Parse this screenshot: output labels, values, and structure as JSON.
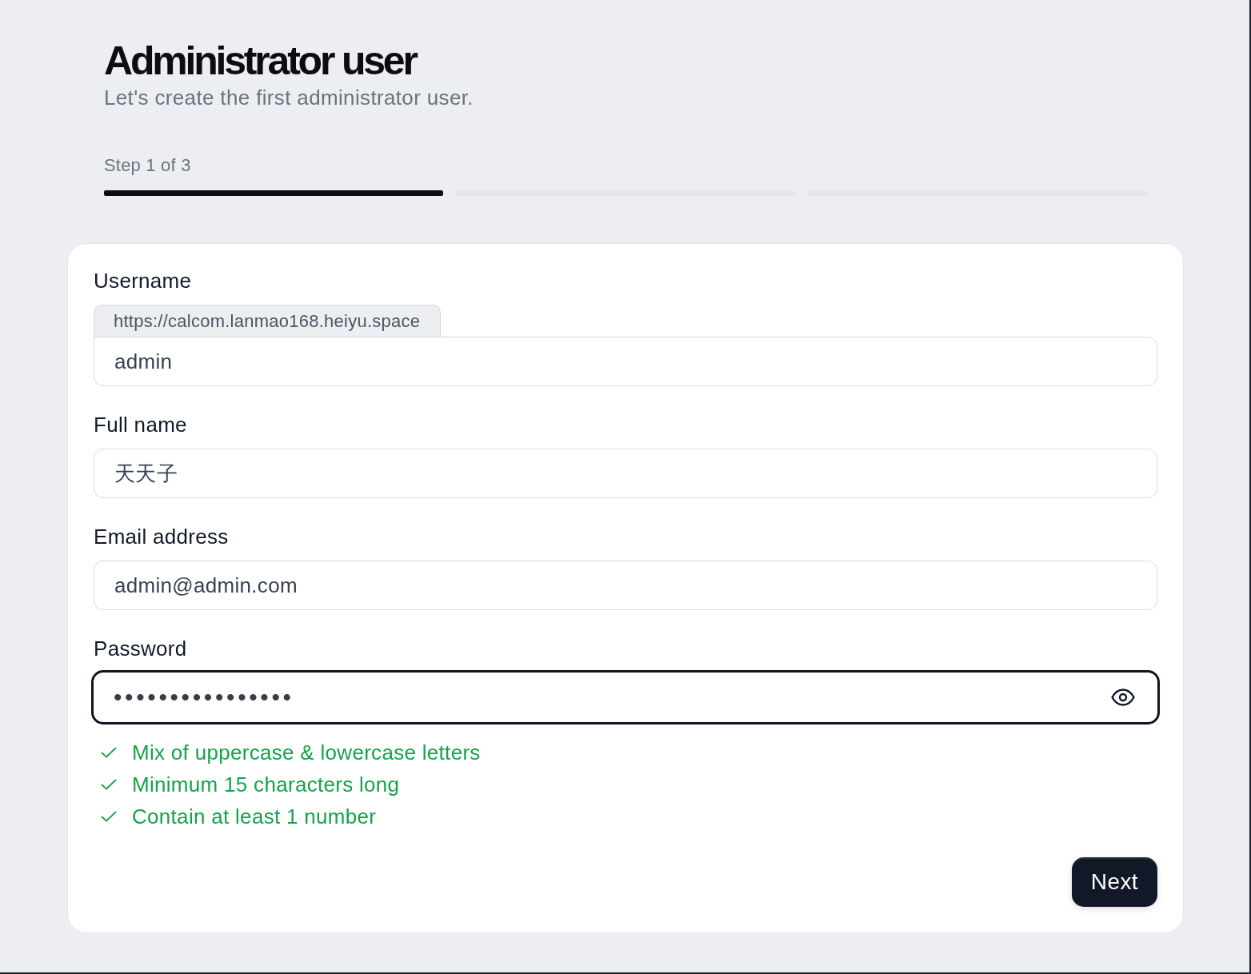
{
  "header": {
    "title": "Administrator user",
    "subtitle": "Let's create the first administrator user."
  },
  "progress": {
    "label": "Step 1 of 3",
    "segments": [
      {
        "filled": true
      },
      {
        "filled": false
      },
      {
        "filled": false
      }
    ]
  },
  "form": {
    "fields": [
      {
        "kind": "prefixed",
        "label": "Username",
        "prefix": "https://calcom.lanmao168.heiyu.space",
        "value": "admin",
        "focused": false
      },
      {
        "kind": "text",
        "label": "Full name",
        "value": "天天子",
        "focused": false
      },
      {
        "kind": "text",
        "label": "Email address",
        "value": "admin@admin.com",
        "focused": false
      },
      {
        "kind": "password",
        "label": "Password",
        "value": "••••••••••••••••",
        "focused": true
      }
    ],
    "requirements": [
      {
        "text": "Mix of uppercase & lowercase letters",
        "met": true
      },
      {
        "text": "Minimum 15 characters long",
        "met": true
      },
      {
        "text": "Contain at least 1 number",
        "met": true
      }
    ],
    "next_button": "Next"
  }
}
